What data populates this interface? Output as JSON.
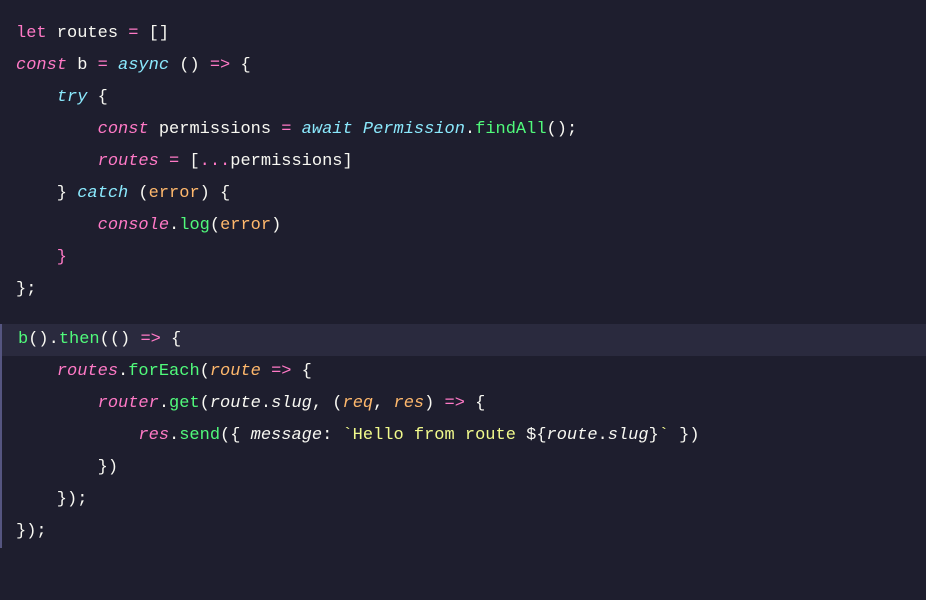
{
  "editor": {
    "background": "#1e1e2e",
    "lines": [
      {
        "id": 1,
        "content": "let routes = []",
        "highlighted": false
      },
      {
        "id": 2,
        "content": "const b = async () => {",
        "highlighted": false
      },
      {
        "id": 3,
        "content": "    try {",
        "highlighted": false
      },
      {
        "id": 4,
        "content": "        const permissions = await Permission.findAll();",
        "highlighted": false
      },
      {
        "id": 5,
        "content": "        routes = [...permissions]",
        "highlighted": false
      },
      {
        "id": 6,
        "content": "    } catch (error) {",
        "highlighted": false
      },
      {
        "id": 7,
        "content": "        console.log(error)",
        "highlighted": false
      },
      {
        "id": 8,
        "content": "    }",
        "highlighted": false
      },
      {
        "id": 9,
        "content": "};",
        "highlighted": false
      },
      {
        "id": 10,
        "content": "",
        "highlighted": false
      },
      {
        "id": 11,
        "content": "b().then(() => {",
        "highlighted": true
      },
      {
        "id": 12,
        "content": "    routes.forEach(route => {",
        "highlighted": false
      },
      {
        "id": 13,
        "content": "        router.get(route.slug, (req, res) => {",
        "highlighted": false
      },
      {
        "id": 14,
        "content": "            res.send({ message: `Hello from route ${route.slug}` })",
        "highlighted": false
      },
      {
        "id": 15,
        "content": "        })",
        "highlighted": false
      },
      {
        "id": 16,
        "content": "    });",
        "highlighted": false
      },
      {
        "id": 17,
        "content": "});",
        "highlighted": false
      }
    ]
  }
}
